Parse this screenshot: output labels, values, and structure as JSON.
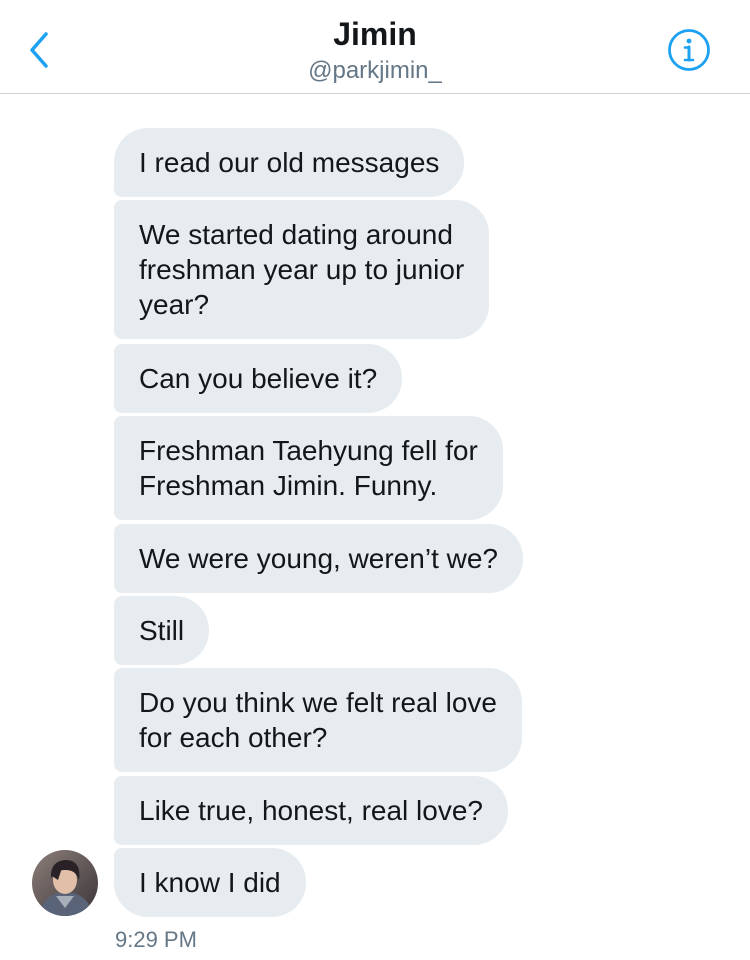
{
  "header": {
    "title": "Jimin",
    "handle": "@parkjimin_",
    "back_icon": "chevron-left-icon",
    "info_icon": "info-icon",
    "accent_color": "#1da1f2"
  },
  "messages": [
    {
      "text": "I read our old messages"
    },
    {
      "text": "We started dating around\nfreshman year up to junior\nyear?"
    },
    {
      "text": "Can you believe it?"
    },
    {
      "text": "Freshman Taehyung fell for\nFreshman Jimin. Funny."
    },
    {
      "text": "We were young, weren’t we?"
    },
    {
      "text": "Still"
    },
    {
      "text": "Do you think we felt real love\nfor each other?"
    },
    {
      "text": "Like true, honest, real love?"
    },
    {
      "text": "I know I did"
    }
  ],
  "timestamp": "9:29 PM",
  "colors": {
    "bubble": "#e6ecf0",
    "text": "#14171a",
    "secondary_text": "#657786"
  }
}
